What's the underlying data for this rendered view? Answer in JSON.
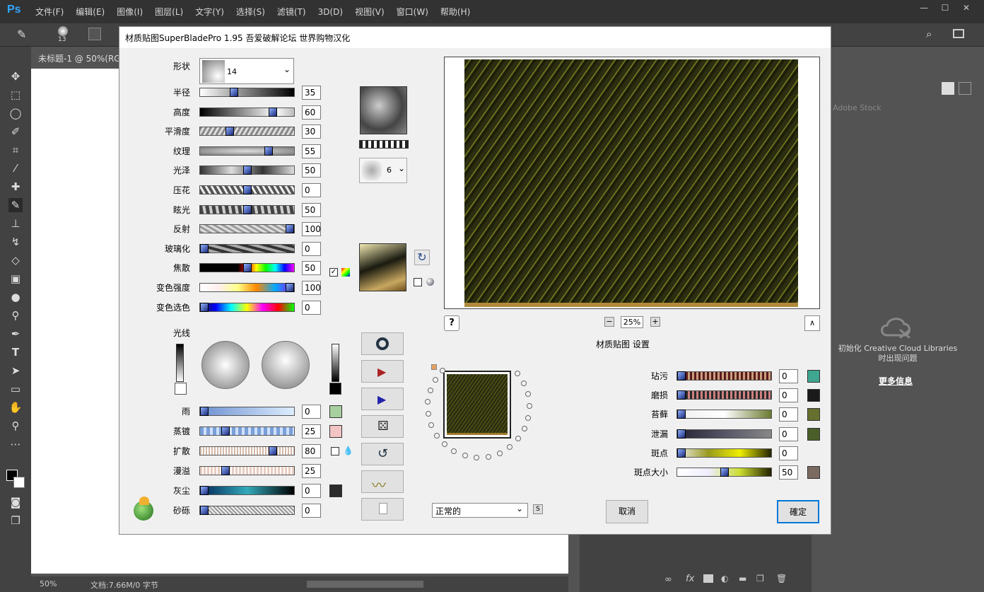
{
  "ps": {
    "logo": "Ps",
    "menu": [
      "文件(F)",
      "编辑(E)",
      "图像(I)",
      "图层(L)",
      "文字(Y)",
      "选择(S)",
      "滤镜(T)",
      "3D(D)",
      "视图(V)",
      "窗口(W)",
      "帮助(H)"
    ],
    "window_controls": [
      "—",
      "☐",
      "✕"
    ],
    "brush_size": "13",
    "doc_tab": "未标题-1 @ 50%(RG",
    "status_zoom": "50%",
    "status_doc": "文档:7.66M/0 字节",
    "cc_text": "初始化 Creative Cloud Libraries 时出现问题",
    "more_info": "更多信息",
    "stock_placeholder": "Adobe Stock"
  },
  "dialog": {
    "title": "材质贴图SuperBladePro 1.95 吾爱破解论坛 世界购物汉化",
    "shape_label": "形状",
    "shape_value": "14",
    "texture_select_value": "6",
    "light_label": "光线",
    "zoom_value": "25%",
    "zoom_minus": "−",
    "zoom_plus": "+",
    "help": "?",
    "collapse": "∧",
    "settings_label": "材质贴图 设置",
    "blend_mode": "正常的",
    "s_button": "S",
    "cancel": "取消",
    "ok": "確定",
    "params": [
      {
        "label": "半径",
        "value": "35",
        "pos": 0.35
      },
      {
        "label": "高度",
        "value": "60",
        "pos": 0.8
      },
      {
        "label": "平滑度",
        "value": "30",
        "pos": 0.3
      },
      {
        "label": "纹理",
        "value": "55",
        "pos": 0.75
      },
      {
        "label": "光泽",
        "value": "50",
        "pos": 0.5
      },
      {
        "label": "压花",
        "value": "0",
        "pos": 0.5
      },
      {
        "label": "眩光",
        "value": "50",
        "pos": 0.5
      },
      {
        "label": "反射",
        "value": "100",
        "pos": 1.0
      },
      {
        "label": "玻璃化",
        "value": "0",
        "pos": 0.0
      },
      {
        "label": "焦散",
        "value": "50",
        "pos": 0.5
      },
      {
        "label": "变色强度",
        "value": "100",
        "pos": 1.0
      },
      {
        "label": "变色选色",
        "value": "0",
        "pos": 0.0
      }
    ],
    "env": [
      {
        "label": "雨",
        "value": "0",
        "pos": 0.0,
        "color": "#a8cfa0"
      },
      {
        "label": "蒸镀",
        "value": "25",
        "pos": 0.25,
        "color": "#f3c4c4"
      },
      {
        "label": "扩散",
        "value": "80",
        "pos": 0.8,
        "color": ""
      },
      {
        "label": "漫溢",
        "value": "25",
        "pos": 0.25,
        "color": ""
      },
      {
        "label": "灰尘",
        "value": "0",
        "pos": 0.0,
        "color": "#2b2b2b"
      },
      {
        "label": "砂砾",
        "value": "0",
        "pos": 0.0,
        "color": ""
      }
    ],
    "weather": [
      {
        "label": "玷污",
        "value": "0",
        "pos": 0.0,
        "color": "#3fa690"
      },
      {
        "label": "磨损",
        "value": "0",
        "pos": 0.0,
        "color": "#1a1a1a"
      },
      {
        "label": "苔藓",
        "value": "0",
        "pos": 0.0,
        "color": "#67702e"
      },
      {
        "label": "泄漏",
        "value": "0",
        "pos": 0.0,
        "color": "#4a5e2a"
      },
      {
        "label": "斑点",
        "value": "0",
        "pos": 0.0,
        "color": ""
      },
      {
        "label": "斑点大小",
        "value": "50",
        "pos": 0.5,
        "color": "#7a6a60"
      }
    ]
  }
}
